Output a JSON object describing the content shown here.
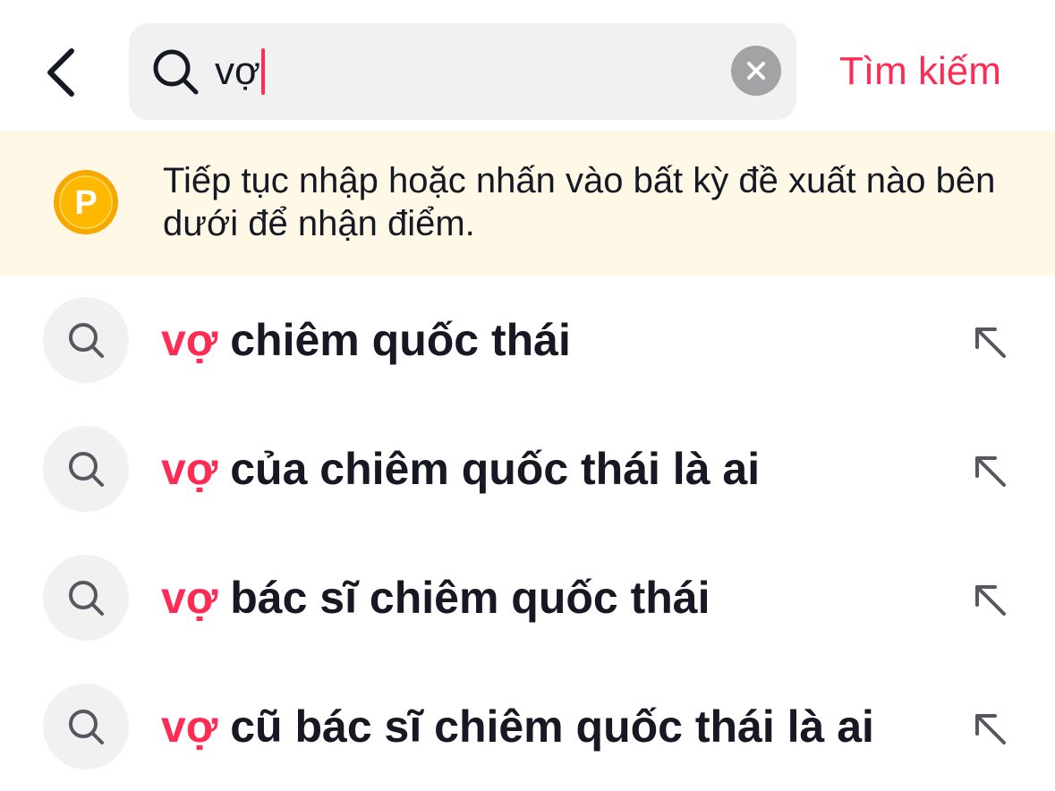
{
  "header": {
    "back_icon": "chevron-left-icon",
    "search": {
      "icon": "search-icon",
      "value": "vợ",
      "clear_icon": "clear-x-icon"
    },
    "submit_label": "Tìm kiếm"
  },
  "banner": {
    "icon": "points-coin-icon",
    "coin_letter": "P",
    "text": "Tiếp tục nhập hoặc nhấn vào bất kỳ đề xuất nào bên dưới để nhận điểm."
  },
  "suggestions": [
    {
      "highlight": "vợ",
      "rest": " chiêm quốc thái"
    },
    {
      "highlight": "vợ",
      "rest": " của chiêm quốc thái là ai"
    },
    {
      "highlight": "vợ",
      "rest": " bác sĩ chiêm quốc thái"
    },
    {
      "highlight": "vợ",
      "rest": " cũ bác sĩ chiêm quốc thái là ai"
    }
  ],
  "colors": {
    "accent": "#fe2c55",
    "text": "#161823",
    "banner_bg": "#fff8e7",
    "input_bg": "#f1f1f2",
    "coin": "#f7a800"
  }
}
